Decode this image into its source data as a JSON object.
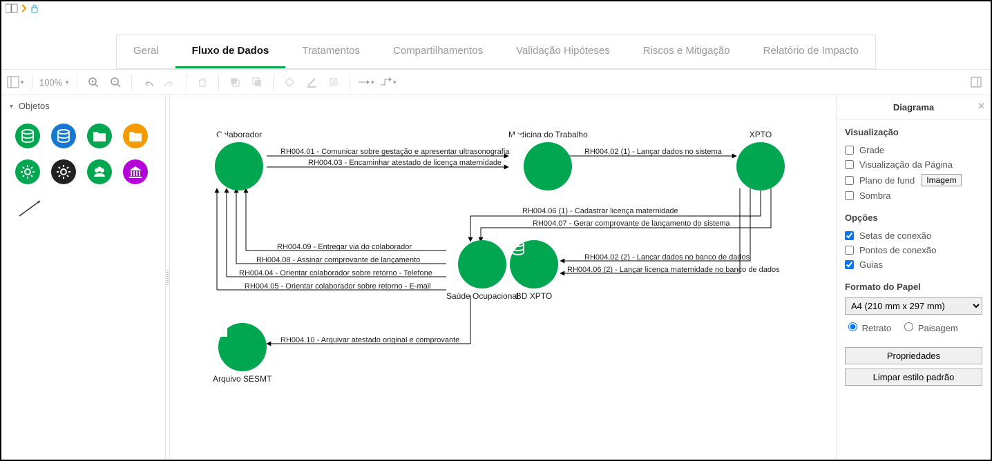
{
  "tabs": [
    "Geral",
    "Fluxo de Dados",
    "Tratamentos",
    "Compartilhamentos",
    "Validação Hipóteses",
    "Riscos e Mitigação",
    "Relatório de Impacto"
  ],
  "activeTab": 1,
  "zoom": "100%",
  "leftPanel": {
    "title": "Objetos"
  },
  "palette": [
    {
      "name": "db-green",
      "color": "#00a650",
      "icon": "db"
    },
    {
      "name": "db-blue",
      "color": "#1778d1",
      "icon": "db"
    },
    {
      "name": "folder-green",
      "color": "#00a650",
      "icon": "folder"
    },
    {
      "name": "folder-orange",
      "color": "#f59a00",
      "icon": "folder"
    },
    {
      "name": "gear-green",
      "color": "#00a650",
      "icon": "gear"
    },
    {
      "name": "gear-black",
      "color": "#222",
      "icon": "gear"
    },
    {
      "name": "group-green",
      "color": "#00a650",
      "icon": "group"
    },
    {
      "name": "bank-purple",
      "color": "#b400d8",
      "icon": "bank"
    }
  ],
  "nodes": {
    "colaborador": "Colaborador",
    "medicina": "Medicina do Trabalho",
    "xpto": "XPTO",
    "saude": "Saúde Ocupacional",
    "bd": "BD XPTO",
    "arquivo": "Arquivo SESMT"
  },
  "edges": {
    "e01": "RH004.01 - Comunicar sobre gestação e apresentar ultrasonografia",
    "e03": "RH004.03 - Encaminhar atestado de licença maternidade",
    "e02_1": "RH004.02 (1) - Lançar dados no sistema",
    "e06_1": "RH004.06 (1) - Cadastrar licença maternidade",
    "e07": "RH004.07 - Gerar comprovante de lançamento do sistema",
    "e02_2": "RH004.02 (2) - Lançar dados no banco de dados",
    "e06_2": "RH004.06 (2) - Lançar licença maternidade no banco de dados",
    "e09": "RH004.09 - Entregar via do colaborador",
    "e08": "RH004.08 - Assinar comprovante de lançamento",
    "e04": "RH004.04 - Orientar colaborador sobre retorno - Telefone",
    "e05": "RH004.05 - Orientar colaborador sobre retorno - E-mail",
    "e10": "RH004.10 - Arquivar atestado original e comprovante"
  },
  "right": {
    "title": "Diagrama",
    "viewSection": "Visualização",
    "grade": "Grade",
    "pageView": "Visualização da Página",
    "background": "Plano de fund",
    "imageBtn": "Imagem",
    "shadow": "Sombra",
    "optionsSection": "Opções",
    "connArrows": "Setas de conexão",
    "connPoints": "Pontos de conexão",
    "guides": "Guias",
    "paperSection": "Formato do Papel",
    "paperSize": "A4 (210 mm x 297 mm)",
    "portrait": "Retrato",
    "landscape": "Paisagem",
    "propsBtn": "Propriedades",
    "clearBtn": "Limpar estilo padrão"
  },
  "chart_data": {
    "type": "diagram",
    "nodes": [
      {
        "id": "colaborador",
        "label": "Colaborador",
        "kind": "group"
      },
      {
        "id": "medicina",
        "label": "Medicina do Trabalho",
        "kind": "group"
      },
      {
        "id": "xpto",
        "label": "XPTO",
        "kind": "system"
      },
      {
        "id": "saude",
        "label": "Saúde Ocupacional",
        "kind": "group"
      },
      {
        "id": "bd",
        "label": "BD XPTO",
        "kind": "database"
      },
      {
        "id": "arquivo",
        "label": "Arquivo SESMT",
        "kind": "folder"
      }
    ],
    "edges": [
      {
        "from": "colaborador",
        "to": "medicina",
        "label": "RH004.01 - Comunicar sobre gestação e apresentar ultrasonografia"
      },
      {
        "from": "colaborador",
        "to": "medicina",
        "label": "RH004.03 - Encaminhar atestado de licença maternidade"
      },
      {
        "from": "medicina",
        "to": "xpto",
        "label": "RH004.02 (1) - Lançar dados no sistema"
      },
      {
        "from": "xpto",
        "to": "saude",
        "label": "RH004.06 (1) - Cadastrar licença maternidade"
      },
      {
        "from": "xpto",
        "to": "saude",
        "label": "RH004.07 - Gerar comprovante de lançamento do sistema"
      },
      {
        "from": "xpto",
        "to": "bd",
        "label": "RH004.02 (2) - Lançar dados no banco de dados"
      },
      {
        "from": "xpto",
        "to": "bd",
        "label": "RH004.06 (2) - Lançar licença maternidade no banco de dados"
      },
      {
        "from": "saude",
        "to": "colaborador",
        "label": "RH004.09 - Entregar via do colaborador"
      },
      {
        "from": "saude",
        "to": "colaborador",
        "label": "RH004.08 - Assinar comprovante de lançamento"
      },
      {
        "from": "saude",
        "to": "colaborador",
        "label": "RH004.04 - Orientar colaborador sobre retorno - Telefone"
      },
      {
        "from": "saude",
        "to": "colaborador",
        "label": "RH004.05 - Orientar colaborador sobre retorno - E-mail"
      },
      {
        "from": "saude",
        "to": "arquivo",
        "label": "RH004.10 - Arquivar atestado original e comprovante"
      }
    ]
  }
}
